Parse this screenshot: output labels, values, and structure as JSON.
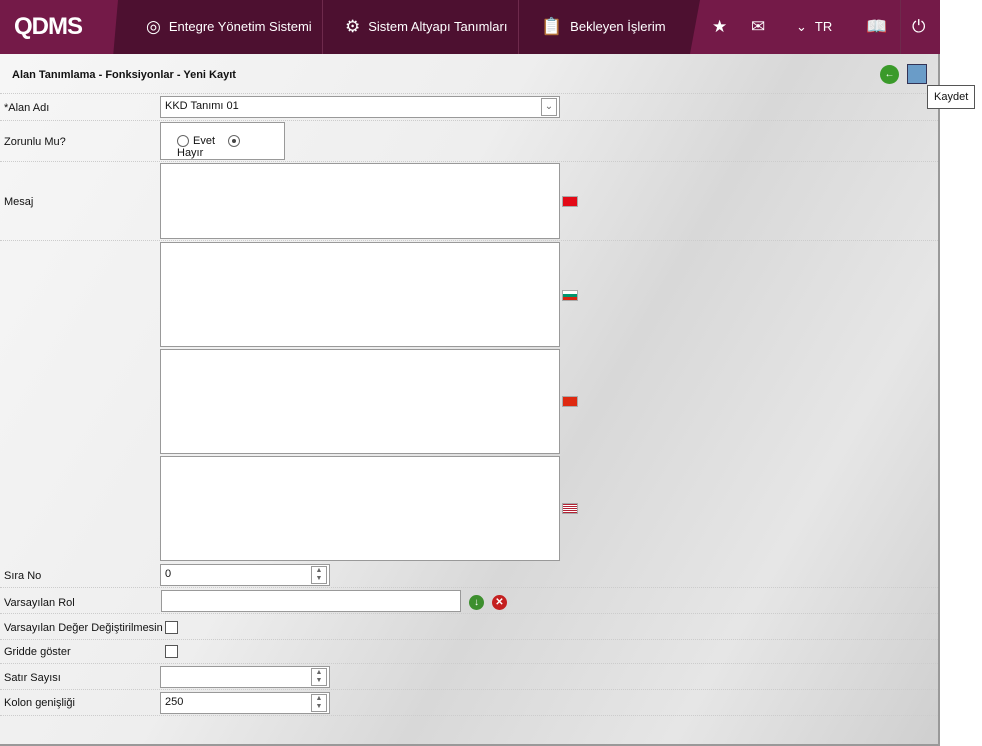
{
  "header": {
    "logo": "QDMS",
    "nav": [
      "Entegre Yönetim Sistemi",
      "Sistem Altyapı Tanımları",
      "Bekleyen İşlerim"
    ],
    "lang": "TR"
  },
  "page": {
    "title": "Alan Tanımlama - Fonksiyonlar - Yeni Kayıt",
    "save_tooltip": "Kaydet"
  },
  "form": {
    "alan_adi": {
      "label": "*Alan Adı",
      "value": "KKD Tanımı  01"
    },
    "zorunlu": {
      "label": "Zorunlu Mu?",
      "options": [
        "Evet",
        "Hayır"
      ],
      "selected": "Hayır"
    },
    "mesaj": {
      "label": "Mesaj",
      "languages": [
        "tr",
        "bg",
        "cn",
        "us"
      ]
    },
    "sira_no": {
      "label": "Sıra No",
      "value": "0"
    },
    "varsayilan_rol": {
      "label": "Varsayılan Rol",
      "value": ""
    },
    "degistirilmesin": {
      "label": "Varsayılan Değer Değiştirilmesin",
      "checked": false
    },
    "gridde": {
      "label": "Gridde göster",
      "checked": false
    },
    "satir_sayisi": {
      "label": "Satır Sayısı",
      "value": ""
    },
    "kolon_genisligi": {
      "label": "Kolon genişliği",
      "value": "250"
    }
  }
}
